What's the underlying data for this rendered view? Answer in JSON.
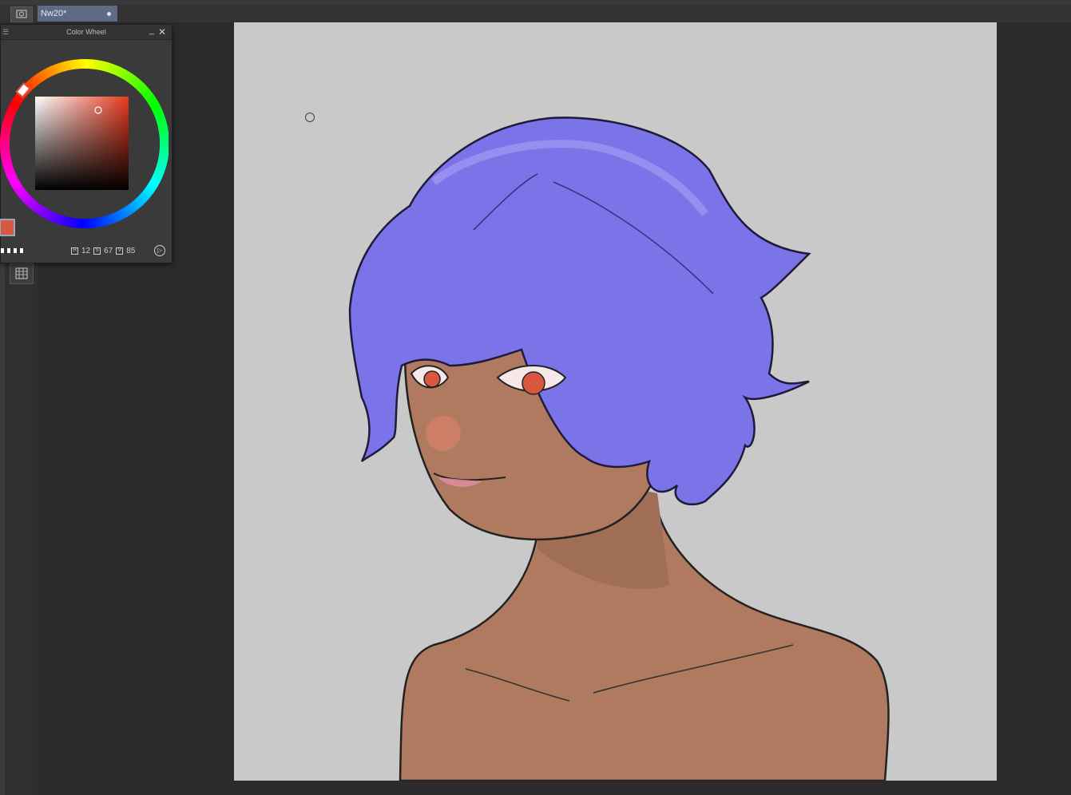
{
  "document_tab": {
    "title": "Nw20*"
  },
  "color_wheel_panel": {
    "title": "Color Wheel",
    "main_color": "#d9573f",
    "sub_color": "#8e2a22",
    "readout": {
      "h_value": "12",
      "s_value": "67",
      "v_value": "85"
    }
  },
  "icons": {
    "camera": "camera-icon",
    "minimize": "minimize-icon",
    "close": "close-icon",
    "grid": "grid-icon",
    "play": "play-icon",
    "brush_cursor": "brush-cursor-icon"
  }
}
